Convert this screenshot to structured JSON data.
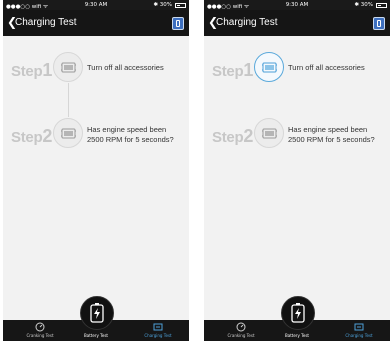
{
  "status_bar": {
    "carrier": "●●●○○ wifi ᯤ",
    "time": "9:30 AM",
    "battery_text": "✱ 30%"
  },
  "header": {
    "back_glyph": "❮",
    "title": "Charging Test"
  },
  "steps": [
    {
      "word": "Step",
      "number": "1",
      "text_line1": "Turn off all accessories",
      "text_line2": ""
    },
    {
      "word": "Step",
      "number": "2",
      "text_line1": "Has engine speed been",
      "text_line2": "2500 RPM for 5 seconds?"
    }
  ],
  "tabs": {
    "cranking": "Cranking Test",
    "battery": "Battery Test",
    "charging": "Charging Test"
  },
  "colors": {
    "accent": "#4da0d8",
    "navbar": "#151515",
    "background": "#f2f2f2",
    "step_label": "#c7c7c7"
  },
  "screens": [
    {
      "step1_active": false
    },
    {
      "step1_active": true
    }
  ]
}
